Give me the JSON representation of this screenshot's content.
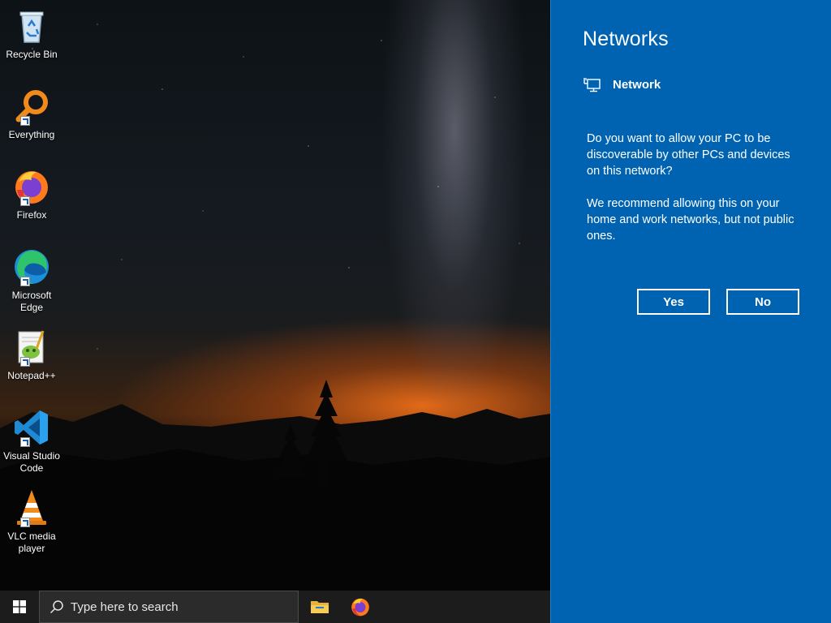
{
  "desktop": {
    "icons": [
      {
        "label": "Recycle Bin",
        "icon": "recycle-bin-icon"
      },
      {
        "label": "Everything",
        "icon": "everything-search-icon"
      },
      {
        "label": "Firefox",
        "icon": "firefox-icon"
      },
      {
        "label": "Microsoft Edge",
        "icon": "edge-icon"
      },
      {
        "label": "Notepad++",
        "icon": "notepad-plus-plus-icon"
      },
      {
        "label": "Visual Studio Code",
        "icon": "vscode-icon"
      },
      {
        "label": "VLC media player",
        "icon": "vlc-icon"
      }
    ]
  },
  "flyout": {
    "title": "Networks",
    "network_name": "Network",
    "question": "Do you want to allow your PC to be discoverable by other PCs and devices on this network?",
    "recommendation": "We recommend allowing this on your home and work networks, but not public ones.",
    "yes_label": "Yes",
    "no_label": "No",
    "background_color": "#0063b1"
  },
  "taskbar": {
    "search_placeholder": "Type here to search",
    "pinned": [
      "file-explorer-icon",
      "firefox-icon"
    ]
  }
}
